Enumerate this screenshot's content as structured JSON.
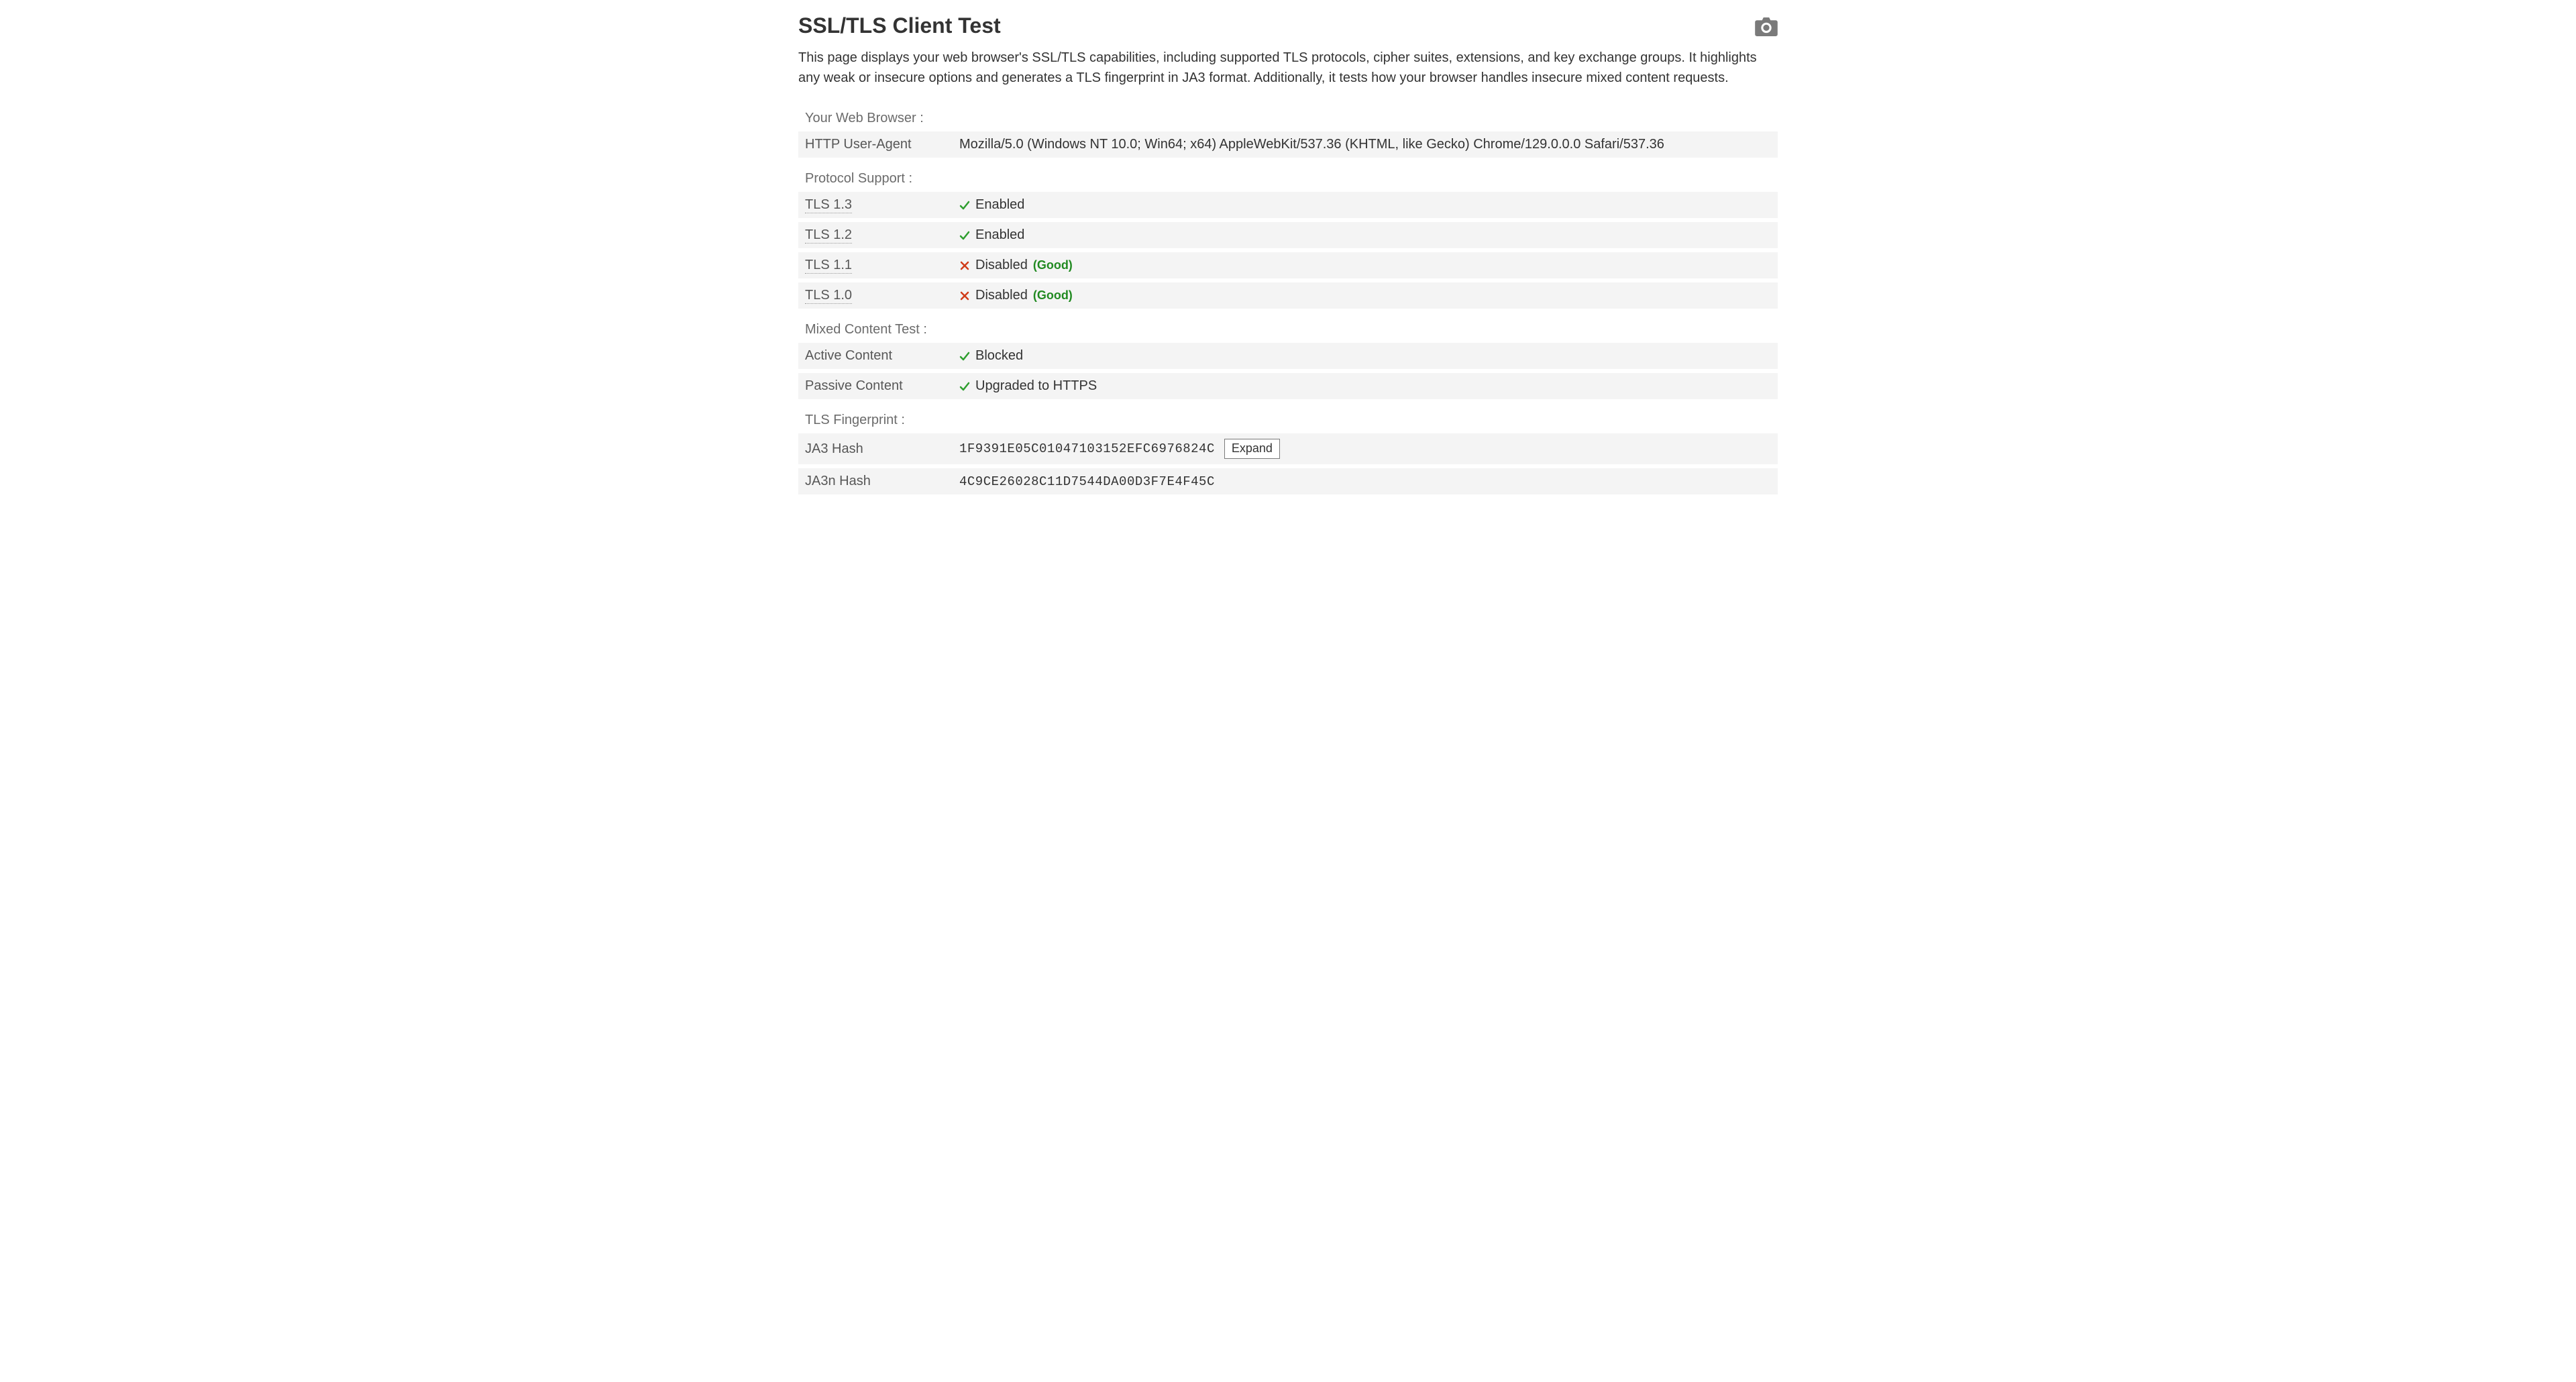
{
  "header": {
    "title": "SSL/TLS Client Test",
    "camera_icon_name": "camera-icon",
    "intro": "This page displays your web browser's SSL/TLS capabilities, including supported TLS protocols, cipher suites, extensions, and key exchange groups. It highlights any weak or insecure options and generates a TLS fingerprint in JA3 format. Additionally, it tests how your browser handles insecure mixed content requests."
  },
  "sections": {
    "browser": {
      "title": "Your Web Browser :",
      "rows": [
        {
          "key": "HTTP User-Agent",
          "value": "Mozilla/5.0 (Windows NT 10.0; Win64; x64) AppleWebKit/537.36 (KHTML, like Gecko) Chrome/129.0.0.0 Safari/537.36"
        }
      ]
    },
    "protocol": {
      "title": "Protocol Support :",
      "rows": [
        {
          "key": "TLS 1.3",
          "status": "check",
          "value": "Enabled",
          "note": ""
        },
        {
          "key": "TLS 1.2",
          "status": "check",
          "value": "Enabled",
          "note": ""
        },
        {
          "key": "TLS 1.1",
          "status": "cross",
          "value": "Disabled",
          "note": "(Good)"
        },
        {
          "key": "TLS 1.0",
          "status": "cross",
          "value": "Disabled",
          "note": "(Good)"
        }
      ]
    },
    "mixed": {
      "title": "Mixed Content Test :",
      "rows": [
        {
          "key": "Active Content",
          "status": "check",
          "value": "Blocked"
        },
        {
          "key": "Passive Content",
          "status": "check",
          "value": "Upgraded to HTTPS"
        }
      ]
    },
    "fingerprint": {
      "title": "TLS Fingerprint :",
      "rows": [
        {
          "key": "JA3 Hash",
          "value": "1F9391E05C01047103152EFC6976824C",
          "expand_label": "Expand"
        },
        {
          "key": "JA3n Hash",
          "value": "4C9CE26028C11D7544DA00D3F7E4F45C"
        }
      ]
    }
  },
  "colors": {
    "bg": "#ffffff",
    "row_bg": "#f4f4f4",
    "text": "#333333",
    "muted": "#6b6b6b",
    "green": "#2e9e2e",
    "red": "#d13c1a"
  }
}
